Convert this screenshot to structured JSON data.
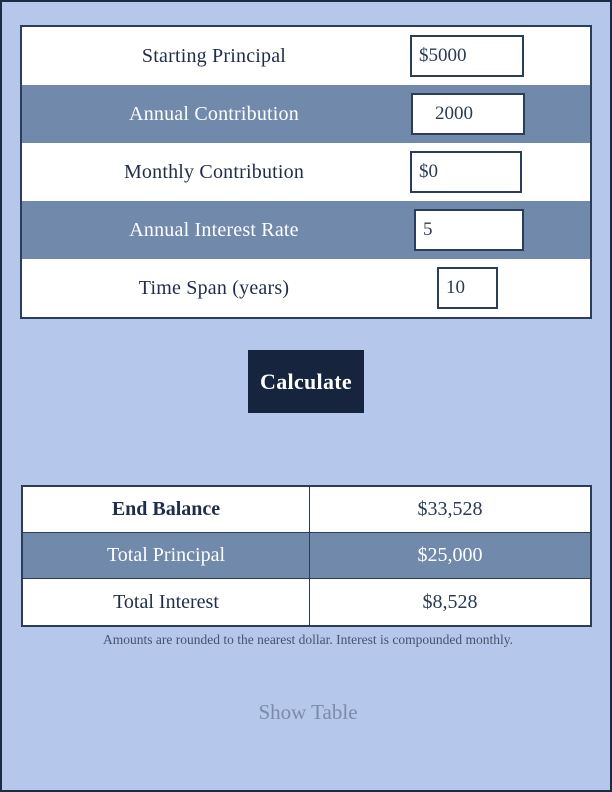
{
  "colors": {
    "page_background": "#b5c7ea",
    "page_border": "#1c2b44",
    "row_alt": "#7189ab",
    "row_base": "#ffffff",
    "field_border": "#2c3d5c",
    "button_background": "#16243d",
    "button_text": "#ffffff",
    "label_text": "#1f2d4a",
    "link_text": "#7b8cab",
    "footnote_text": "#47536b"
  },
  "input_form": {
    "rows": [
      {
        "label": "Starting Principal",
        "value": "$5000",
        "field_name": "starting-principal-input"
      },
      {
        "label": "Annual Contribution",
        "value": "2000",
        "field_name": "annual-contribution-input"
      },
      {
        "label": "Monthly Contribution",
        "value": "$0",
        "field_name": "monthly-contribution-input"
      },
      {
        "label": "Annual Interest Rate",
        "value": "5",
        "field_name": "annual-interest-rate-input"
      },
      {
        "label": "Time Span (years)",
        "value": "10",
        "field_name": "time-span-input"
      }
    ]
  },
  "actions": {
    "calculate_label": "Calculate",
    "show_table_label": "Show Table"
  },
  "results": {
    "rows": [
      {
        "label": "End Balance",
        "value": "$33,528"
      },
      {
        "label": "Total Principal",
        "value": "$25,000"
      },
      {
        "label": "Total Interest",
        "value": "$8,528"
      }
    ]
  },
  "footnote": "Amounts are rounded to the nearest dollar. Interest is compounded monthly."
}
